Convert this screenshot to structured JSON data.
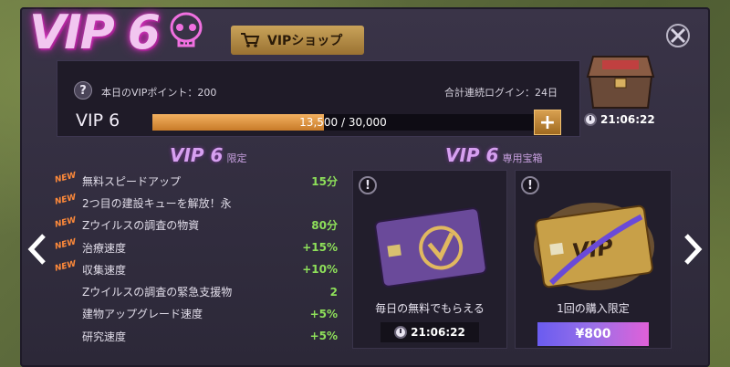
{
  "header": {
    "vip_logo": "VIP 6",
    "shop_tab_label": "VIPショップ"
  },
  "status": {
    "daily_points": "本日のVIPポイント：200",
    "login_days": "合計連続ログイン：24日",
    "vip_level": "VIP 6",
    "progress_text": "13,500 / 30,000",
    "progress_fraction": 0.45,
    "chest_timer": "21:06:22"
  },
  "perks": {
    "title_big": "VIP 6",
    "title_small": "限定",
    "new_tag": "NEW",
    "items": [
      {
        "label": "無料スピードアップ",
        "value": "15分",
        "is_new": true
      },
      {
        "label": "2つ目の建設キューを解放！永",
        "value": "",
        "is_new": true
      },
      {
        "label": "Zウイルスの調査の物資",
        "value": "80分",
        "is_new": true
      },
      {
        "label": "治療速度",
        "value": "+15%",
        "is_new": true
      },
      {
        "label": "収集速度",
        "value": "+10%",
        "is_new": true
      },
      {
        "label": "Zウイルスの調査の緊急支援物",
        "value": "2",
        "is_new": false
      },
      {
        "label": "建物アップグレード速度",
        "value": "+5%",
        "is_new": false
      },
      {
        "label": "研究速度",
        "value": "+5%",
        "is_new": false
      }
    ]
  },
  "chests": {
    "title_big": "VIP 6",
    "title_small": "専用宝箱",
    "free": {
      "label": "毎日の無料でもらえる",
      "timer": "21:06:22"
    },
    "paid": {
      "label": "1回の購入限定",
      "price": "¥800"
    }
  },
  "colors": {
    "accent_orange": "#c87a28",
    "perk_value_green": "#8ee05a",
    "neon_pink": "#e040c8",
    "price_gradient_start": "#6a5cf0",
    "price_gradient_end": "#e060d8"
  },
  "icons": [
    "skull-icon",
    "cart-icon",
    "close-icon",
    "help-icon",
    "plus-icon",
    "clock-icon",
    "alert-icon",
    "chevron-left-icon",
    "chevron-right-icon"
  ]
}
